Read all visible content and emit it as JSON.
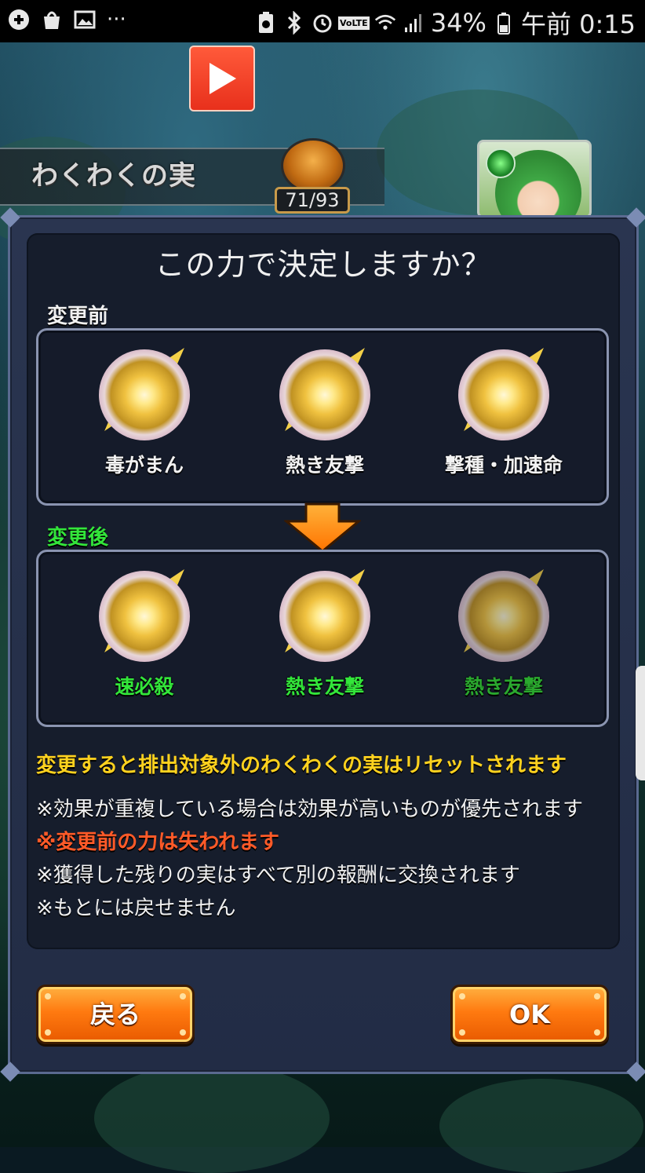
{
  "status_bar": {
    "battery": "34%",
    "time": "午前 0:15",
    "icons_left": [
      "game-controller-icon",
      "bag-icon",
      "image-icon",
      "more-icon"
    ],
    "icons_right": [
      "battery-saver-icon",
      "bluetooth-icon",
      "alarm-icon",
      "volte-icon",
      "wifi-icon",
      "signal-icon",
      "battery-icon"
    ],
    "more": "···",
    "volte": "VoLTE"
  },
  "game": {
    "screen_title": "わくわくの実",
    "counter": "71/93"
  },
  "dialog": {
    "title": "この力で決定しますか？",
    "before_label": "変更前",
    "after_label": "変更後",
    "before_items": [
      "毒がまん",
      "熱き友撃",
      "撃種・加速命"
    ],
    "after_items": [
      "速必殺",
      "熱き友撃",
      "熱き友撃"
    ],
    "warning": "変更すると排出対象外のわくわくの実はリセットされます",
    "notes": [
      "※効果が重複している場合は効果が高いものが優先されます",
      "※変更前の力は失われます",
      "※獲得した残りの実はすべて別の報酬に交換されます",
      "※もとには戻せません"
    ],
    "back_button": "戻る",
    "ok_button": "OK"
  },
  "colors": {
    "accent_orange": "#ff7a10",
    "warning_yellow": "#ffd21e",
    "alert_red": "#ff5a28",
    "after_green": "#33e63a"
  }
}
